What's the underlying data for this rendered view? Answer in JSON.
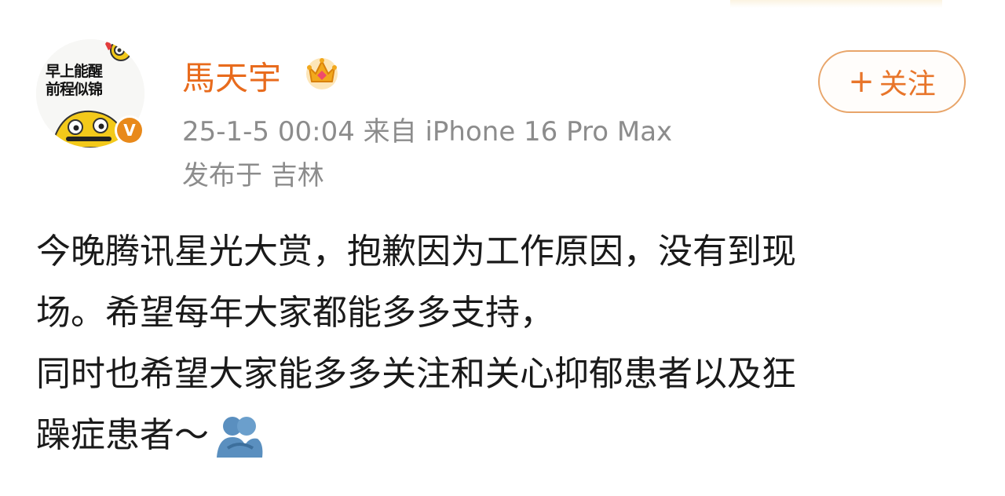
{
  "user": {
    "avatar_text_line1": "早上能醒",
    "avatar_text_line2": "前程似锦",
    "name": "馬天宇",
    "verified_mark": "V",
    "crown_icon": "crown-icon",
    "verified_color": "#e8891a",
    "name_color": "#e86b1d"
  },
  "post": {
    "meta": "25-1-5 00:04  来自 iPhone 16 Pro Max",
    "location": "发布于 吉林",
    "lines": [
      "今晚腾讯星光大赏，抱歉因为工作原因，没有到现",
      "场。希望每年大家都能多多支持，",
      "同时也希望大家能多多关注和关心抑郁患者以及狂",
      "躁症患者～"
    ],
    "emoji_icon": "hug-emoji-icon"
  },
  "actions": {
    "follow_plus": "+",
    "follow_label": "关注",
    "accent_color": "#e8752a"
  }
}
